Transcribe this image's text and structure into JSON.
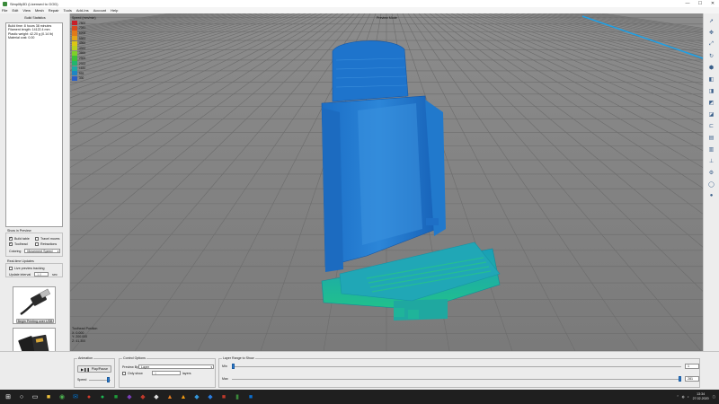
{
  "window": {
    "title": "Simplify3D (Licensed to GOD)",
    "min": "—",
    "max": "☐",
    "close": "✕"
  },
  "menu": [
    "File",
    "Edit",
    "View",
    "Mesh",
    "Repair",
    "Tools",
    "Add-Ins",
    "Account",
    "Help"
  ],
  "build_stats": {
    "heading": "Build Statistics",
    "lines": [
      "Build time: 8 hours 38 minutes",
      "Filament length: 14122.4 mm",
      "Plastic weight: 42.20 g (0.14 lb)",
      "Material cost: 0.00"
    ]
  },
  "preview_options": {
    "heading": "Show in Preview",
    "build_table_label": "Build table",
    "build_table_checked": true,
    "travel_moves_label": "Travel moves",
    "travel_moves_checked": false,
    "toolhead_label": "Toolhead",
    "toolhead_checked": true,
    "retractions_label": "Retractions",
    "retractions_checked": false,
    "coloring_label": "Coloring",
    "coloring_value": "Movement Speed"
  },
  "realtime": {
    "heading": "Real-time Updates",
    "live_tracking_label": "Live preview tracking",
    "live_tracking_checked": false,
    "interval_label": "Update interval",
    "interval_value": "1.0",
    "interval_unit": "sec"
  },
  "usb_card": {
    "label": "Begin Printing over USB"
  },
  "sd_card": {
    "label": "Save Toolpaths to Disk"
  },
  "exit_button": {
    "label": "Exit Preview Mode"
  },
  "viewport": {
    "mode_label": "Preview Mode",
    "legend_title": "Speed (mm/min)",
    "legend": [
      {
        "value": "7800",
        "color": "#c8202a"
      },
      {
        "value": "7041",
        "color": "#d84a1f"
      },
      {
        "value": "6208",
        "color": "#e07a1a"
      },
      {
        "value": "5583",
        "color": "#e3a617"
      },
      {
        "value": "4966",
        "color": "#dcc615"
      },
      {
        "value": "4333",
        "color": "#b8d21e"
      },
      {
        "value": "3666",
        "color": "#7fcf2a"
      },
      {
        "value": "2900",
        "color": "#3ec03a"
      },
      {
        "value": "2333",
        "color": "#22b56e"
      },
      {
        "value": "1630",
        "color": "#1ea8a4"
      },
      {
        "value": "993",
        "color": "#1f86c4"
      },
      {
        "value": "330",
        "color": "#2a5fc8"
      }
    ],
    "toolhead_title": "Toolhead Position",
    "toolhead_x": "X: 0.000",
    "toolhead_y": "Y: 200.000",
    "toolhead_z": "Z: 41.300"
  },
  "right_tools": [
    "pointer-icon",
    "move-icon",
    "zoom-icon",
    "rotate-icon",
    "iso-view-icon",
    "front-view-icon",
    "back-view-icon",
    "left-view-icon",
    "right-view-icon",
    "top-view-icon",
    "bottom-view-icon",
    "cross-section-icon",
    "toolhead-icon",
    "gear-icon",
    "sphere-icon",
    "help-icon"
  ],
  "animation": {
    "heading": "Animation",
    "play_label": "Play/Pause",
    "speed_label": "Speed",
    "speed_level": 0.95
  },
  "control": {
    "heading": "Control Options",
    "preview_by_label": "Preview By",
    "preview_by_value": "Layer",
    "only_show_label": "Only show",
    "only_show_value": "1",
    "layers_label": "layers"
  },
  "layer_range": {
    "heading": "Layer Range to Show",
    "min_label": "Min",
    "max_label": "Max",
    "min_value": "1",
    "max_value": "281",
    "min_level": 0.0,
    "max_level": 1.0
  },
  "taskbar": {
    "time": "13:34",
    "date": "27.02.2020"
  }
}
